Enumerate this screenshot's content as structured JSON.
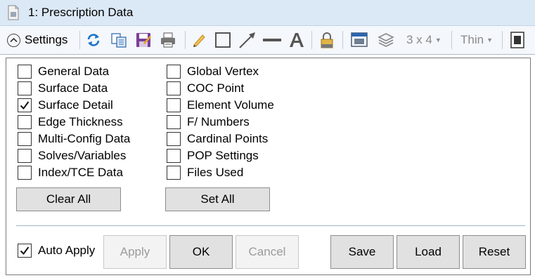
{
  "window": {
    "title": "1: Prescription Data"
  },
  "toolbar": {
    "settings_label": "Settings",
    "grid_label": "3 x 4",
    "line_label": "Thin",
    "icons": [
      "refresh-icon",
      "copy-icon",
      "save-icon",
      "print-icon",
      "pencil-icon",
      "rectangle-icon",
      "arrow-icon",
      "line-icon",
      "text-icon",
      "lock-icon",
      "window-icon",
      "layers-icon",
      "window-single-icon"
    ]
  },
  "options": {
    "left": [
      {
        "label": "General Data",
        "checked": false
      },
      {
        "label": "Surface Data",
        "checked": false
      },
      {
        "label": "Surface Detail",
        "checked": true
      },
      {
        "label": "Edge Thickness",
        "checked": false
      },
      {
        "label": "Multi-Config Data",
        "checked": false
      },
      {
        "label": "Solves/Variables",
        "checked": false
      },
      {
        "label": "Index/TCE Data",
        "checked": false
      }
    ],
    "right": [
      {
        "label": "Global Vertex",
        "checked": false
      },
      {
        "label": "COC Point",
        "checked": false
      },
      {
        "label": "Element Volume",
        "checked": false
      },
      {
        "label": "F/ Numbers",
        "checked": false
      },
      {
        "label": "Cardinal Points",
        "checked": false
      },
      {
        "label": "POP Settings",
        "checked": false
      },
      {
        "label": "Files Used",
        "checked": false
      }
    ]
  },
  "buttons": {
    "clear_all": "Clear All",
    "set_all": "Set All",
    "apply": "Apply",
    "ok": "OK",
    "cancel": "Cancel",
    "save": "Save",
    "load": "Load",
    "reset": "Reset"
  },
  "auto_apply": {
    "label": "Auto Apply",
    "checked": true
  }
}
